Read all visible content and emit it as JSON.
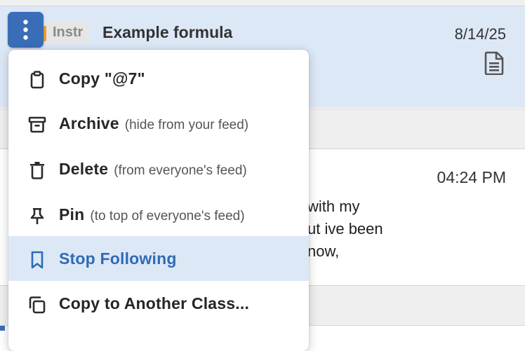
{
  "post_1": {
    "badge": "Instr",
    "title": "Example formula",
    "date": "8/14/25",
    "icon": "note-icon"
  },
  "post_2": {
    "time": "04:24 PM",
    "snippet_lines": [
      "with my",
      "ut ive been",
      "now,"
    ]
  },
  "more_button": {
    "icon": "vertical-ellipsis-icon"
  },
  "menu": {
    "items": [
      {
        "label": "Copy \"@7\"",
        "hint": "",
        "icon": "clipboard-icon"
      },
      {
        "label": "Archive",
        "hint": "(hide from your feed)",
        "icon": "archive-icon"
      },
      {
        "label": "Delete",
        "hint": "(from everyone's feed)",
        "icon": "trash-icon"
      },
      {
        "label": "Pin",
        "hint": "(to top of everyone's feed)",
        "icon": "pin-icon"
      },
      {
        "label": "Stop Following",
        "hint": "",
        "icon": "bookmark-icon"
      },
      {
        "label": "Copy to Another Class...",
        "hint": "",
        "icon": "copy-icon"
      }
    ],
    "active_item": "Stop Following"
  },
  "colors": {
    "accent": "#3a6db8",
    "selected_row": "#dde8f7",
    "feed_gap": "#efefef",
    "badge_orange": "#f0a030"
  }
}
